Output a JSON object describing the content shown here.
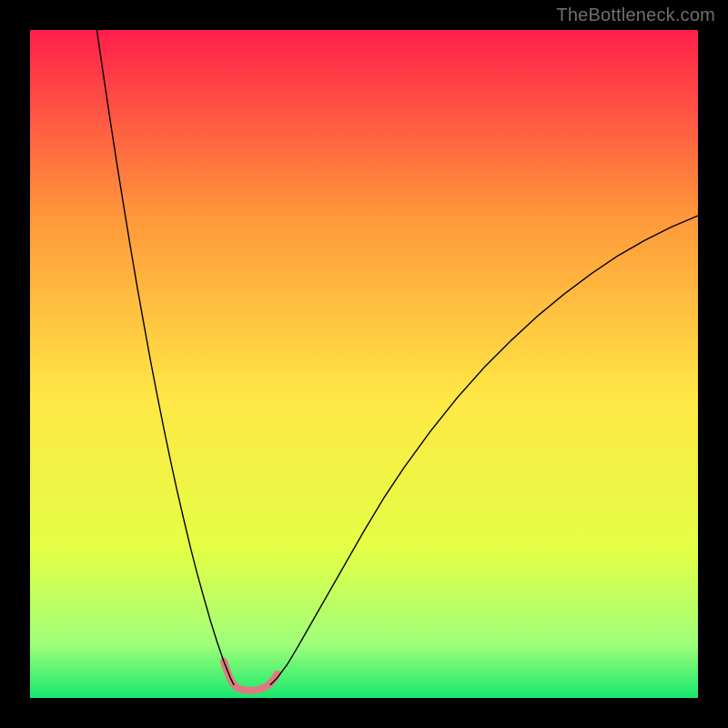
{
  "watermark": "TheBottleneck.com",
  "chart_data": {
    "type": "line",
    "title": "",
    "xlabel": "",
    "ylabel": "",
    "xlim": [
      0,
      100
    ],
    "ylim": [
      0,
      100
    ],
    "grid": false,
    "legend": false,
    "background_gradient": {
      "top": "#ff1f4a",
      "mid_upper": "#ff983a",
      "mid": "#ffe745",
      "mid_lower": "#e3ff45",
      "near_bottom": "#9fff7a",
      "bottom": "#17e86e"
    },
    "series": [
      {
        "name": "left-branch",
        "color": "#000000",
        "width": 1.4,
        "x": [
          10.0,
          11.0,
          12.0,
          13.0,
          14.0,
          15.0,
          16.0,
          17.0,
          18.0,
          19.0,
          20.0,
          21.0,
          22.0,
          23.0,
          24.0,
          25.0,
          26.0,
          27.0,
          28.0,
          29.0,
          30.0,
          30.5
        ],
        "y": [
          100.0,
          93.2,
          86.5,
          80.0,
          73.8,
          67.7,
          61.8,
          56.2,
          50.7,
          45.5,
          40.5,
          35.7,
          31.1,
          26.8,
          22.6,
          18.7,
          15.1,
          11.6,
          8.4,
          5.5,
          3.0,
          2.0
        ]
      },
      {
        "name": "right-branch",
        "color": "#000000",
        "width": 1.4,
        "x": [
          36.0,
          37.0,
          38.5,
          40.0,
          42.0,
          44.0,
          46.0,
          48.0,
          50.0,
          53.0,
          56.0,
          60.0,
          64.0,
          68.0,
          72.0,
          76.0,
          80.0,
          84.0,
          88.0,
          92.0,
          96.0,
          100.0
        ],
        "y": [
          2.0,
          3.0,
          5.0,
          7.5,
          11.0,
          14.5,
          18.0,
          21.5,
          25.0,
          30.0,
          34.5,
          40.0,
          45.0,
          49.5,
          53.5,
          57.2,
          60.5,
          63.5,
          66.2,
          68.5,
          70.5,
          72.2
        ]
      },
      {
        "name": "bottom-highlight",
        "color": "#e07a82",
        "width": 8,
        "x": [
          29.0,
          29.5,
          30.0,
          30.5,
          31.0,
          32.0,
          33.0,
          34.0,
          35.0,
          35.5,
          36.0,
          36.5,
          37.0
        ],
        "y": [
          5.5,
          4.0,
          2.8,
          2.0,
          1.5,
          1.2,
          1.1,
          1.2,
          1.5,
          1.8,
          2.2,
          2.8,
          3.6
        ]
      }
    ]
  }
}
